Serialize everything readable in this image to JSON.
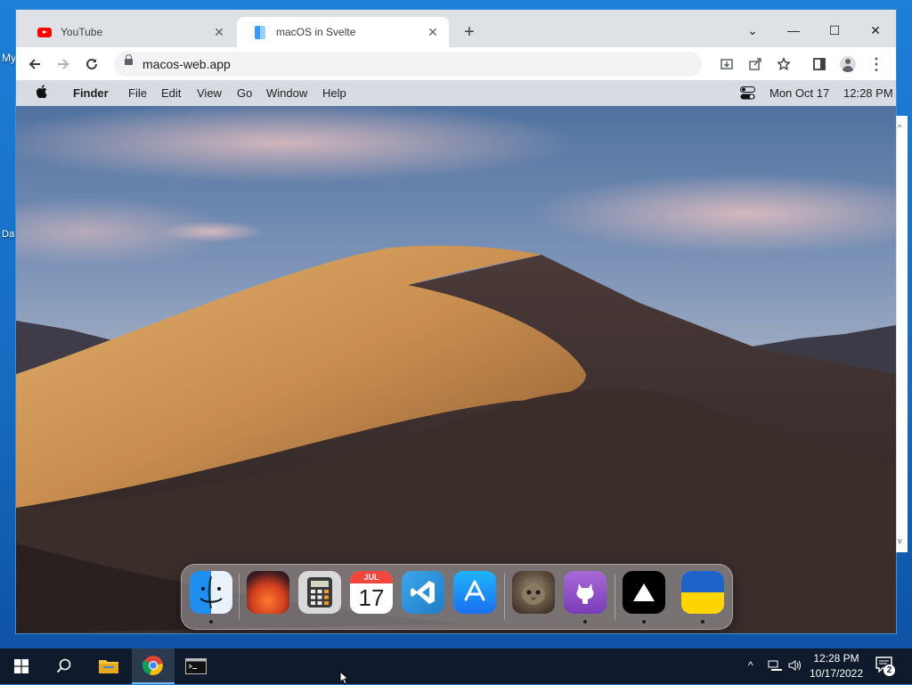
{
  "desktop": {
    "label_1": "My",
    "label_2": "Da"
  },
  "browser": {
    "tabs": [
      {
        "title": "YouTube",
        "favicon": "youtube-icon"
      },
      {
        "title": "macOS in Svelte",
        "favicon": "finder-icon"
      }
    ],
    "url": "macos-web.app",
    "controls": {
      "minimize": "—",
      "maximize": "☐",
      "close": "✕",
      "chevron": "⌄"
    }
  },
  "macos": {
    "menubar": {
      "app": "Finder",
      "items": [
        "File",
        "Edit",
        "View",
        "Go",
        "Window",
        "Help"
      ],
      "date": "Mon Oct 17",
      "time": "12:28 PM"
    },
    "dock": {
      "apps": [
        {
          "name": "Finder",
          "icon": "finder-icon",
          "running": true
        },
        {
          "name": "Wallpapers",
          "icon": "wallpapers-icon",
          "running": false
        },
        {
          "name": "Calculator",
          "icon": "calculator-icon",
          "running": false
        },
        {
          "name": "Calendar",
          "icon": "calendar-icon",
          "running": false
        },
        {
          "name": "VS Code",
          "icon": "vscode-icon",
          "running": false
        },
        {
          "name": "App Store",
          "icon": "app-store-icon",
          "running": false
        },
        {
          "name": "Purrfect",
          "icon": "cat-icon",
          "running": false
        },
        {
          "name": "GitHub",
          "icon": "github-icon",
          "running": true
        },
        {
          "name": "Vercel",
          "icon": "vercel-icon",
          "running": true
        },
        {
          "name": "Ukraine",
          "icon": "ukraine-flag-icon",
          "running": true
        }
      ],
      "calendar_month": "JUL",
      "calendar_day": "17"
    }
  },
  "taskbar": {
    "time": "12:28 PM",
    "date": "10/17/2022",
    "notifications": "2"
  }
}
